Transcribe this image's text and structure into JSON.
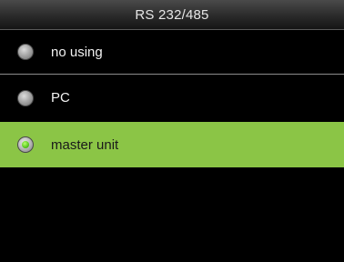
{
  "title_bar": {
    "title": "RS 232/485"
  },
  "options": [
    {
      "label": "no using",
      "selected": false
    },
    {
      "label": "PC",
      "selected": false
    },
    {
      "label": "master unit",
      "selected": true
    }
  ],
  "colors": {
    "selected_row": "#8bc546",
    "background": "#000000",
    "selected_indicator": "#58c81e"
  },
  "icons": {
    "radio_unselected": "radio-unselected-icon",
    "radio_selected": "radio-selected-icon"
  }
}
